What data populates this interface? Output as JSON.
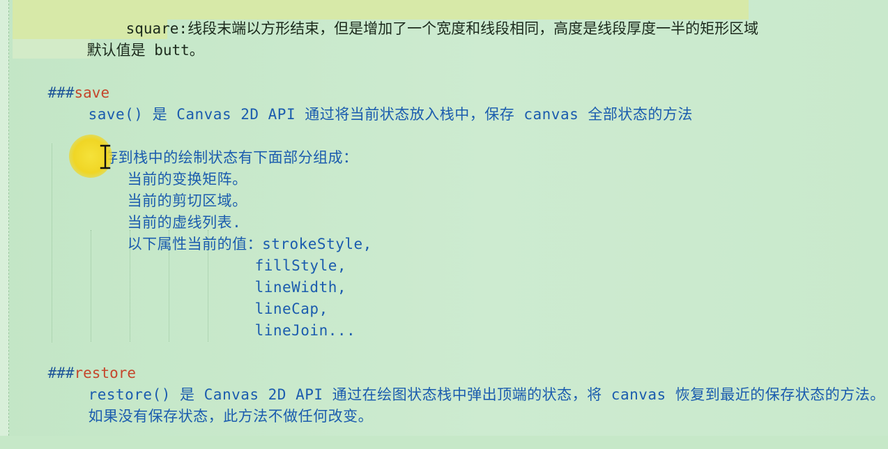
{
  "editor": {
    "lines": {
      "square_desc": "square:线段末端以方形结束，但是增加了一个宽度和线段相同，高度是线段厚度一半的矩形区域",
      "default_value": "默认值是 butt。",
      "save_hash": "###",
      "save_heading": "save",
      "save_desc": "save() 是 Canvas 2D API 通过将当前状态放入栈中，保存 canvas 全部状态的方法",
      "save_list_intro": "保存到栈中的绘制状态有下面部分组成：",
      "item_transform": "当前的变换矩阵。",
      "item_clip": "当前的剪切区域。",
      "item_dash": "当前的虚线列表.",
      "item_props": "以下属性当前的值：strokeStyle,",
      "prop_fill": "fillStyle,",
      "prop_linewidth": "lineWidth,",
      "prop_linecap": "lineCap,",
      "prop_linejoin": "lineJoin...",
      "restore_hash": "###",
      "restore_heading": "restore",
      "restore_desc": "restore() 是 Canvas 2D API 通过在绘图状态栈中弹出顶端的状态，将 canvas 恢复到最近的保存状态的方法。",
      "restore_note": "如果没有保存状态，此方法不做任何改变。"
    }
  },
  "cursor": {
    "icon": "i-beam-cursor-icon",
    "highlight_color": "#f0d625"
  },
  "colors": {
    "background": "#c6e8c8",
    "text": "#1b5cae",
    "heading": "#c5462c",
    "selection": "#d7e9a8"
  }
}
